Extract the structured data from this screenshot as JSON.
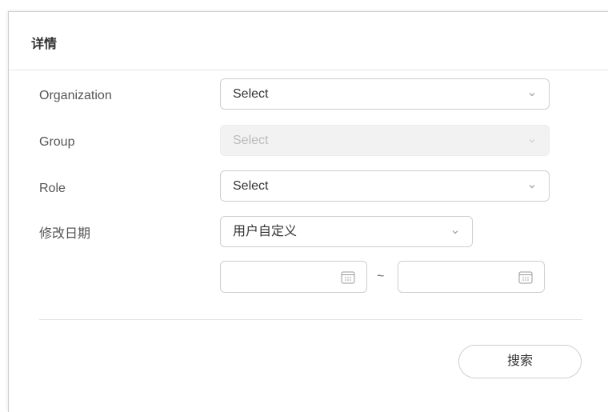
{
  "panel": {
    "title": "详情"
  },
  "form": {
    "organization": {
      "label": "Organization",
      "value": "Select",
      "disabled": false
    },
    "group": {
      "label": "Group",
      "value": "Select",
      "disabled": true
    },
    "role": {
      "label": "Role",
      "value": "Select",
      "disabled": false
    },
    "modified_date": {
      "label": "修改日期",
      "range_type": "用户自定义",
      "start_date": "",
      "end_date": "",
      "separator": "~"
    }
  },
  "actions": {
    "search_label": "搜索"
  },
  "icons": {
    "dropdown": "chevron-down-icon",
    "date": "calendar-icon"
  },
  "colors": {
    "border": "#cfcfcf",
    "disabled_bg": "#f2f2f2",
    "text": "#333333"
  }
}
